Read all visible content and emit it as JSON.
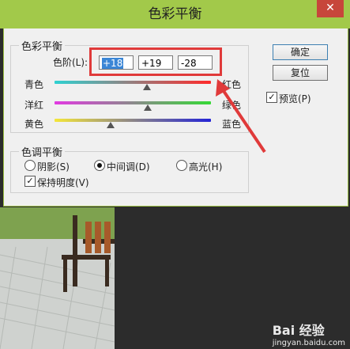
{
  "window": {
    "title": "色彩平衡",
    "close_label": "✕"
  },
  "color_balance": {
    "legend": "色彩平衡",
    "levels_label": "色阶(L):",
    "levels": [
      "+18",
      "+19",
      "-28"
    ],
    "sliders": [
      {
        "left": "青色",
        "right": "红色",
        "value": 18
      },
      {
        "left": "洋红",
        "right": "绿色",
        "value": 19
      },
      {
        "left": "黄色",
        "right": "蓝色",
        "value": -28
      }
    ]
  },
  "tone_balance": {
    "legend": "色调平衡",
    "options": [
      "阴影(S)",
      "中间调(D)",
      "高光(H)"
    ],
    "selected": "中间调(D)",
    "preserve_luminosity": "保持明度(V)",
    "preserve_checked": true
  },
  "buttons": {
    "ok": "确定",
    "reset": "复位",
    "preview": "预览(P)",
    "preview_checked": true
  },
  "watermark": {
    "logo": "Bai 经验",
    "url": "jingyan.baidu.com"
  },
  "colors": {
    "titlebar": "#a2c94a",
    "highlight_box": "#e03a3a",
    "selection": "#3b86d6"
  }
}
